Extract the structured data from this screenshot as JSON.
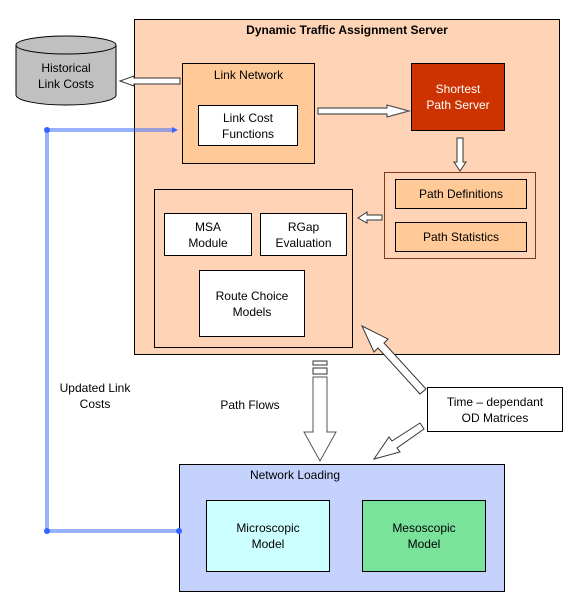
{
  "colors": {
    "server_bg": "#ffd4b6",
    "inner_orange": "#ffc998",
    "path_box_bg": "#ffc998",
    "shortest_path_bg": "#cc3300",
    "loading_bg": "#c5d2fd",
    "micro_bg": "#ccffff",
    "meso_bg": "#79e29b",
    "db_bg": "#c0c0c0",
    "feedback_line": "#3366ff"
  },
  "diagram": {
    "server": {
      "title": "Dynamic Traffic Assignment Server"
    },
    "historical_db": {
      "label": "Historical\nLink Costs"
    },
    "link_network": {
      "title": "Link Network",
      "cost_functions": "Link Cost\nFunctions"
    },
    "shortest_path": {
      "label": "Shortest\nPath Server"
    },
    "path_group": {
      "definitions": "Path Definitions",
      "statistics": "Path Statistics"
    },
    "assignment_group": {
      "msa": "MSA\nModule",
      "rgap": "RGap\nEvaluation",
      "route_choice": "Route Choice\nModels"
    },
    "od_matrices": {
      "label": "Time – dependant\nOD Matrices"
    },
    "network_loading": {
      "title": "Network Loading",
      "micro": "Microscopic\nModel",
      "meso": "Mesoscopic\nModel"
    },
    "labels": {
      "updated_link_costs": "Updated Link\nCosts",
      "path_flows": "Path Flows"
    }
  }
}
